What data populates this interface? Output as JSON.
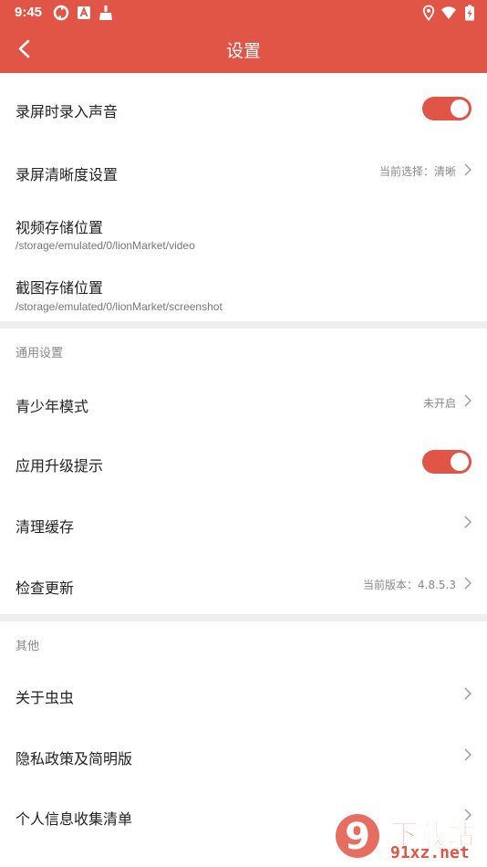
{
  "status_bar": {
    "time": "9:45",
    "left_icons": [
      "sync-icon",
      "a-box-icon",
      "broom-icon"
    ],
    "right_icons": [
      "location-icon",
      "wifi-icon",
      "battery-icon"
    ]
  },
  "toolbar": {
    "title": "设置",
    "back_icon": "chevron-left-icon"
  },
  "colors": {
    "accent": "#e05545",
    "divider": "#eeeeee",
    "secondary_text": "#888888"
  },
  "screen_settings": {
    "record_audio": {
      "label": "录屏时录入声音",
      "enabled": true
    },
    "clarity": {
      "label": "录屏清晰度设置",
      "value": "当前选择：清晰"
    },
    "video_path": {
      "label": "视频存储位置",
      "path": "/storage/emulated/0/lionMarket/video"
    },
    "screenshot_path": {
      "label": "截图存储位置",
      "path": "/storage/emulated/0/lionMarket/screenshot"
    }
  },
  "general": {
    "header": "通用设置",
    "youth_mode": {
      "label": "青少年模式",
      "value": "未开启"
    },
    "upgrade_hint": {
      "label": "应用升级提示",
      "enabled": true
    },
    "clear_cache": {
      "label": "清理缓存"
    },
    "check_update": {
      "label": "检查更新",
      "value": "当前版本：4.8.5.3"
    }
  },
  "other": {
    "header": "其他",
    "about": {
      "label": "关于虫虫"
    },
    "privacy": {
      "label": "隐私政策及简明版"
    },
    "personal_info": {
      "label": "个人信息收集清单"
    }
  },
  "watermark": {
    "text": "下载站",
    "domain": "91xz.net",
    "logo_text": "9"
  }
}
